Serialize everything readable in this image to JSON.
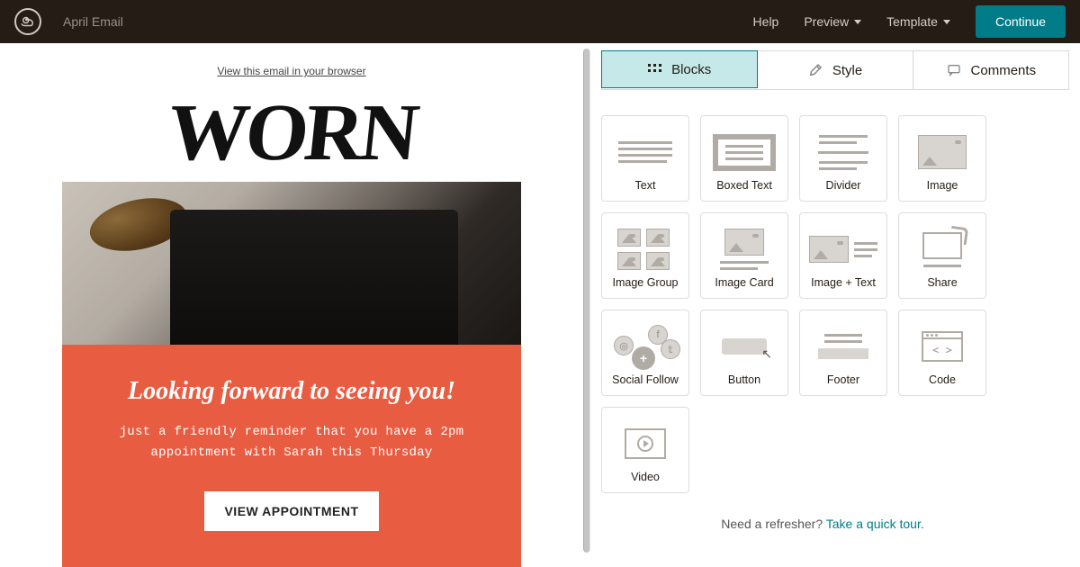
{
  "header": {
    "title": "April Email",
    "help": "Help",
    "preview": "Preview",
    "template": "Template",
    "continue": "Continue"
  },
  "preview": {
    "view_link": "View this email in your browser",
    "brand": "WORN",
    "headline": "Looking forward to seeing you!",
    "body": "just a friendly reminder that you have a 2pm appointment with Sarah this Thursday",
    "cta": "VIEW APPOINTMENT"
  },
  "tabs": {
    "blocks": "Blocks",
    "style": "Style",
    "comments": "Comments"
  },
  "blocks": [
    {
      "label": "Text"
    },
    {
      "label": "Boxed Text"
    },
    {
      "label": "Divider"
    },
    {
      "label": "Image"
    },
    {
      "label": "Image Group"
    },
    {
      "label": "Image Card"
    },
    {
      "label": "Image + Text"
    },
    {
      "label": "Share"
    },
    {
      "label": "Social Follow"
    },
    {
      "label": "Button"
    },
    {
      "label": "Footer"
    },
    {
      "label": "Code"
    },
    {
      "label": "Video"
    }
  ],
  "footer_help": {
    "text": "Need a refresher? ",
    "link": "Take a quick tour",
    "period": "."
  },
  "colors": {
    "accent": "#007c89",
    "panel": "#e85c41",
    "topbar": "#241c15"
  }
}
